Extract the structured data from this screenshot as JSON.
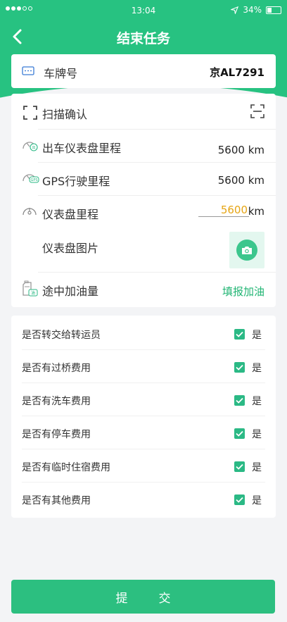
{
  "status_bar": {
    "time": "13:04",
    "battery": "34%"
  },
  "nav": {
    "title": "结束任务"
  },
  "plate": {
    "label": "车牌号",
    "value": "京AL7291"
  },
  "scan": {
    "label": "扫描确认"
  },
  "mileage": {
    "departure_label": "出车仪表盘里程",
    "departure_value": "5600 km",
    "gps_label": "GPS行驶里程",
    "gps_value": "5600 km",
    "odometer_label": "仪表盘里程",
    "odometer_input": "5600",
    "odometer_unit": "km",
    "photo_label": "仪表盘图片"
  },
  "fuel": {
    "label": "途中加油量",
    "action": "填报加油"
  },
  "questions": [
    {
      "label": "是否转交给转运员",
      "checked": true,
      "option": "是"
    },
    {
      "label": "是否有过桥费用",
      "checked": true,
      "option": "是"
    },
    {
      "label": "是否有洗车费用",
      "checked": true,
      "option": "是"
    },
    {
      "label": "是否有停车费用",
      "checked": true,
      "option": "是"
    },
    {
      "label": "是否有临时住宿费用",
      "checked": true,
      "option": "是"
    },
    {
      "label": "是否有其他费用",
      "checked": true,
      "option": "是"
    }
  ],
  "submit": {
    "label": "提交"
  },
  "colors": {
    "primary": "#27c281",
    "accent_input": "#e6a514",
    "background": "#f3f4f6"
  }
}
